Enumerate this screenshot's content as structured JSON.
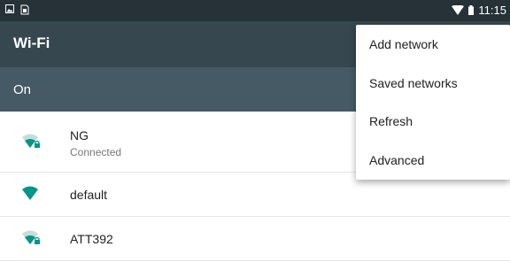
{
  "status_bar": {
    "time": "11:15",
    "icons": [
      "image-icon",
      "sim-card-icon",
      "wifi-signal-icon",
      "battery-icon"
    ]
  },
  "app_bar": {
    "title": "Wi-Fi"
  },
  "wifi_switch": {
    "label": "On"
  },
  "networks": [
    {
      "name": "NG",
      "status": "Connected",
      "icon": "wifi-lock-icon"
    },
    {
      "name": "default",
      "icon": "wifi-full-icon"
    },
    {
      "name": "ATT392",
      "icon": "wifi-lock-icon"
    }
  ],
  "menu": {
    "items": [
      "Add network",
      "Saved networks",
      "Refresh",
      "Advanced"
    ]
  },
  "colors": {
    "status_bar": "#263238",
    "app_bar": "#37474f",
    "switch_bar": "#455a64",
    "accent": "#009688"
  }
}
